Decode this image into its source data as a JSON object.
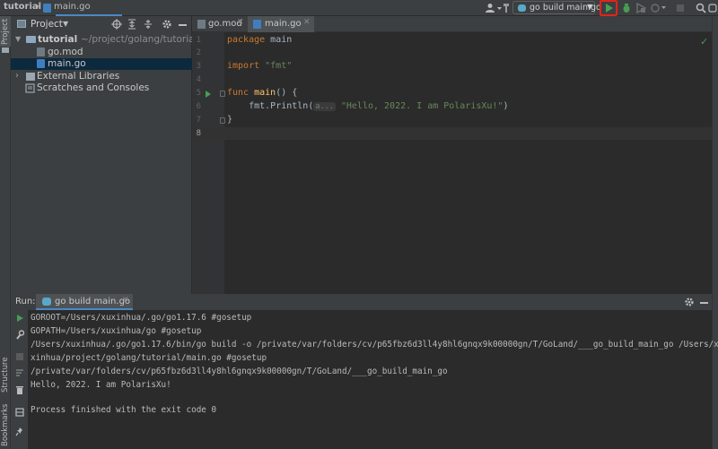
{
  "navbar": {
    "project": "tutorial",
    "separator": "›",
    "file": "main.go",
    "run_config": "go build main.go"
  },
  "left_strip": {
    "project": "Project",
    "structure": "Structure",
    "bookmarks": "Bookmarks"
  },
  "project_panel": {
    "title": "Project",
    "tree": {
      "root_name": "tutorial",
      "root_path": "~/project/golang/tutorial",
      "go_mod": "go.mod",
      "main_go": "main.go",
      "external_libraries": "External Libraries",
      "scratches": "Scratches and Consoles"
    }
  },
  "editor": {
    "tabs": [
      "go.mod",
      "main.go"
    ],
    "active_tab": "main.go",
    "line_numbers": [
      "1",
      "2",
      "3",
      "4",
      "5",
      "6",
      "7",
      "8"
    ],
    "current_line": "8",
    "code": {
      "l1_kw": "package",
      "l1_rest": " main",
      "l3_kw": "import",
      "l3_str": " \"fmt\"",
      "l5_kw": "func",
      "l5_fn": " main",
      "l5_rest": "() {",
      "l6_indent": "    ",
      "l6_call": "fmt.Println(",
      "l6_hint": "a...",
      "l6_str": "\"Hello, 2022. I am PolarisXu!\"",
      "l6_end": ")",
      "l7": "}"
    }
  },
  "run_panel": {
    "label": "Run:",
    "tab": "go build main.go",
    "console": [
      "GOROOT=/Users/xuxinhua/.go/go1.17.6 #gosetup",
      "GOPATH=/Users/xuxinhua/go #gosetup",
      "/Users/xuxinhua/.go/go1.17.6/bin/go build -o /private/var/folders/cv/p65fbz6d3ll4y8hl6gnqx9k00000gn/T/GoLand/___go_build_main_go /Users/xu",
      "xinhua/project/golang/tutorial/main.go #gosetup",
      "/private/var/folders/cv/p65fbz6d3ll4y8hl6gnqx9k00000gn/T/GoLand/___go_build_main_go",
      "Hello, 2022. I am PolarisXu!",
      "",
      "Process finished with the exit code 0"
    ]
  },
  "colors": {
    "run_green": "#499c54",
    "highlight_red": "#e2231a",
    "accent_blue": "#4a88c7"
  },
  "icons": [
    "user-icon",
    "hammer-icon",
    "run-icon",
    "debug-icon",
    "coverage-icon",
    "profile-icon",
    "stop-icon",
    "search-icon",
    "gear-icon"
  ]
}
